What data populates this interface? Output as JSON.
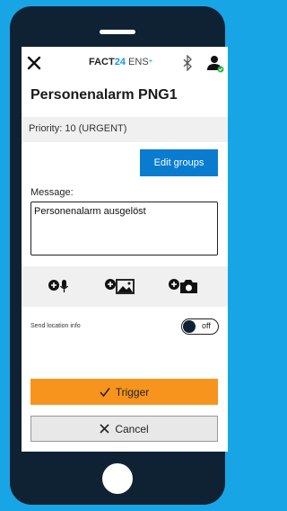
{
  "brand": {
    "fact": "FACT",
    "num": "24",
    "ens": " ENS",
    "plus": "+"
  },
  "alarm": {
    "title": "Personenalarm PNG1"
  },
  "priority": {
    "text": "Priority: 10 (URGENT)"
  },
  "groups": {
    "edit_label": "Edit groups"
  },
  "message": {
    "label": "Message:",
    "value": "Personenalarm ausgelöst"
  },
  "location": {
    "label": "Send location info",
    "toggle_state": "off"
  },
  "actions": {
    "trigger_label": "Trigger",
    "cancel_label": "Cancel"
  },
  "colors": {
    "background": "#18a5e6",
    "phone": "#0e2233",
    "accent_blue": "#0a7cd0",
    "trigger_orange": "#f7941d",
    "status_green": "#2bb24c"
  },
  "icons": {
    "close": "close-icon",
    "bluetooth": "bluetooth-icon",
    "user": "user-icon",
    "mic": "add-voice-icon",
    "image": "add-image-icon",
    "camera": "add-photo-icon",
    "check": "check-icon",
    "cancel": "x-icon"
  }
}
